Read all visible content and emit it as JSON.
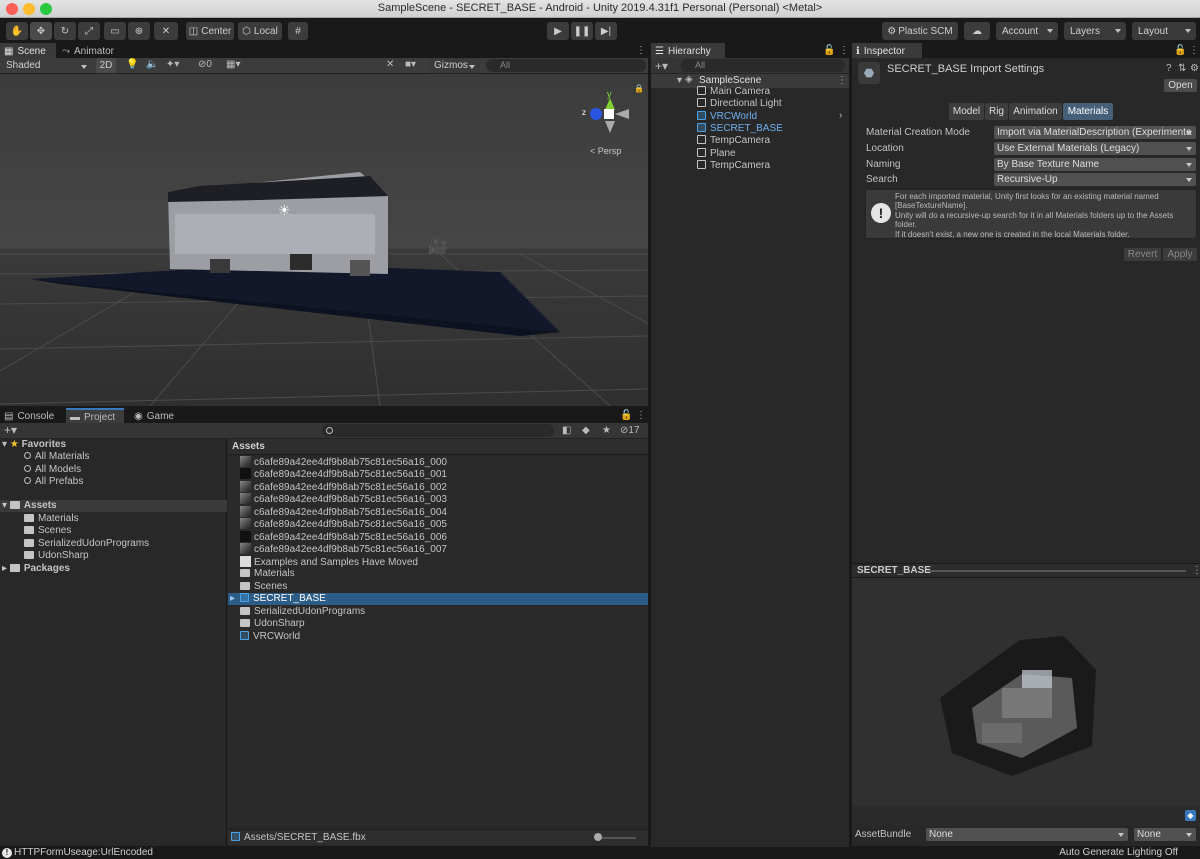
{
  "window": {
    "title": "SampleScene - SECRET_BASE - Android - Unity 2019.4.31f1 Personal (Personal) <Metal>"
  },
  "toolbar": {
    "center_label": "Center",
    "local_label": "Local",
    "plastic_label": "Plastic SCM",
    "account_label": "Account",
    "layers_label": "Layers",
    "layout_label": "Layout"
  },
  "scene_panel": {
    "tabs": [
      "Scene",
      "Animator"
    ],
    "shading_mode": "Shaded",
    "mode_2d": "2D",
    "hidden_count": "0",
    "gizmos_label": "Gizmos",
    "search_placeholder": "All",
    "persp_label": "Persp",
    "gizmo_y": "y"
  },
  "hierarchy": {
    "tab": "Hierarchy",
    "search_placeholder": "All",
    "scene": "SampleScene",
    "items": [
      {
        "label": "Main Camera",
        "type": "gameobject"
      },
      {
        "label": "Directional Light",
        "type": "gameobject"
      },
      {
        "label": "VRCWorld",
        "type": "prefab"
      },
      {
        "label": "SECRET_BASE",
        "type": "prefab"
      },
      {
        "label": "TempCamera",
        "type": "gameobject"
      },
      {
        "label": "Plane",
        "type": "gameobject"
      },
      {
        "label": "TempCamera",
        "type": "gameobject"
      }
    ]
  },
  "inspector": {
    "tab": "Inspector",
    "header": "SECRET_BASE Import Settings",
    "open_button": "Open",
    "subtabs": [
      "Model",
      "Rig",
      "Animation",
      "Materials"
    ],
    "active_subtab": "Materials",
    "fields": [
      {
        "label": "Material Creation Mode",
        "value": "Import via MaterialDescription (Experimenta"
      },
      {
        "label": "Location",
        "value": "Use External Materials (Legacy)"
      },
      {
        "label": "Naming",
        "value": "By Base Texture Name"
      },
      {
        "label": "Search",
        "value": "Recursive-Up"
      }
    ],
    "info_lines": [
      "For each imported material, Unity first looks for an existing material named",
      "[BaseTextureName].",
      "Unity will do a recursive-up search for it in all Materials folders up to the Assets",
      "folder.",
      "If it doesn't exist, a new one is created in the local Materials folder."
    ],
    "revert_button": "Revert",
    "apply_button": "Apply",
    "preview_title": "SECRET_BASE",
    "assetbundle_label": "AssetBundle",
    "assetbundle_value": "None",
    "assetbundle_variant": "None"
  },
  "bottom_panel": {
    "tabs": [
      "Console",
      "Project",
      "Game"
    ],
    "active_tab": "Project",
    "hidden_count": "17",
    "favorites_label": "Favorites",
    "favorites": [
      "All Materials",
      "All Models",
      "All Prefabs"
    ],
    "assets_label": "Assets",
    "asset_folders": [
      "Materials",
      "Scenes",
      "SerializedUdonPrograms",
      "UdonSharp"
    ],
    "packages_label": "Packages",
    "breadcrumb": "Assets",
    "files": [
      {
        "label": "c6afe89a42ee4df9b8ab75c81ec56a16_000",
        "kind": "texture"
      },
      {
        "label": "c6afe89a42ee4df9b8ab75c81ec56a16_001",
        "kind": "texture"
      },
      {
        "label": "c6afe89a42ee4df9b8ab75c81ec56a16_002",
        "kind": "texture"
      },
      {
        "label": "c6afe89a42ee4df9b8ab75c81ec56a16_003",
        "kind": "texture"
      },
      {
        "label": "c6afe89a42ee4df9b8ab75c81ec56a16_004",
        "kind": "texture"
      },
      {
        "label": "c6afe89a42ee4df9b8ab75c81ec56a16_005",
        "kind": "texture"
      },
      {
        "label": "c6afe89a42ee4df9b8ab75c81ec56a16_006",
        "kind": "texture"
      },
      {
        "label": "c6afe89a42ee4df9b8ab75c81ec56a16_007",
        "kind": "texture"
      },
      {
        "label": "Examples and Samples Have Moved",
        "kind": "document"
      },
      {
        "label": "Materials",
        "kind": "folder"
      },
      {
        "label": "Scenes",
        "kind": "folder"
      },
      {
        "label": "SECRET_BASE",
        "kind": "model"
      },
      {
        "label": "SerializedUdonPrograms",
        "kind": "folder"
      },
      {
        "label": "UdonSharp",
        "kind": "folder"
      },
      {
        "label": "VRCWorld",
        "kind": "prefab"
      }
    ],
    "selected_file": "SECRET_BASE",
    "footer_path": "Assets/SECRET_BASE.fbx"
  },
  "statusbar": {
    "message": "HTTPFormUseage:UrlEncoded",
    "right": "Auto Generate Lighting Off"
  },
  "colors": {
    "selection": "#2c5d87",
    "accent_blue": "#4aa3e8",
    "panel": "#282828"
  }
}
